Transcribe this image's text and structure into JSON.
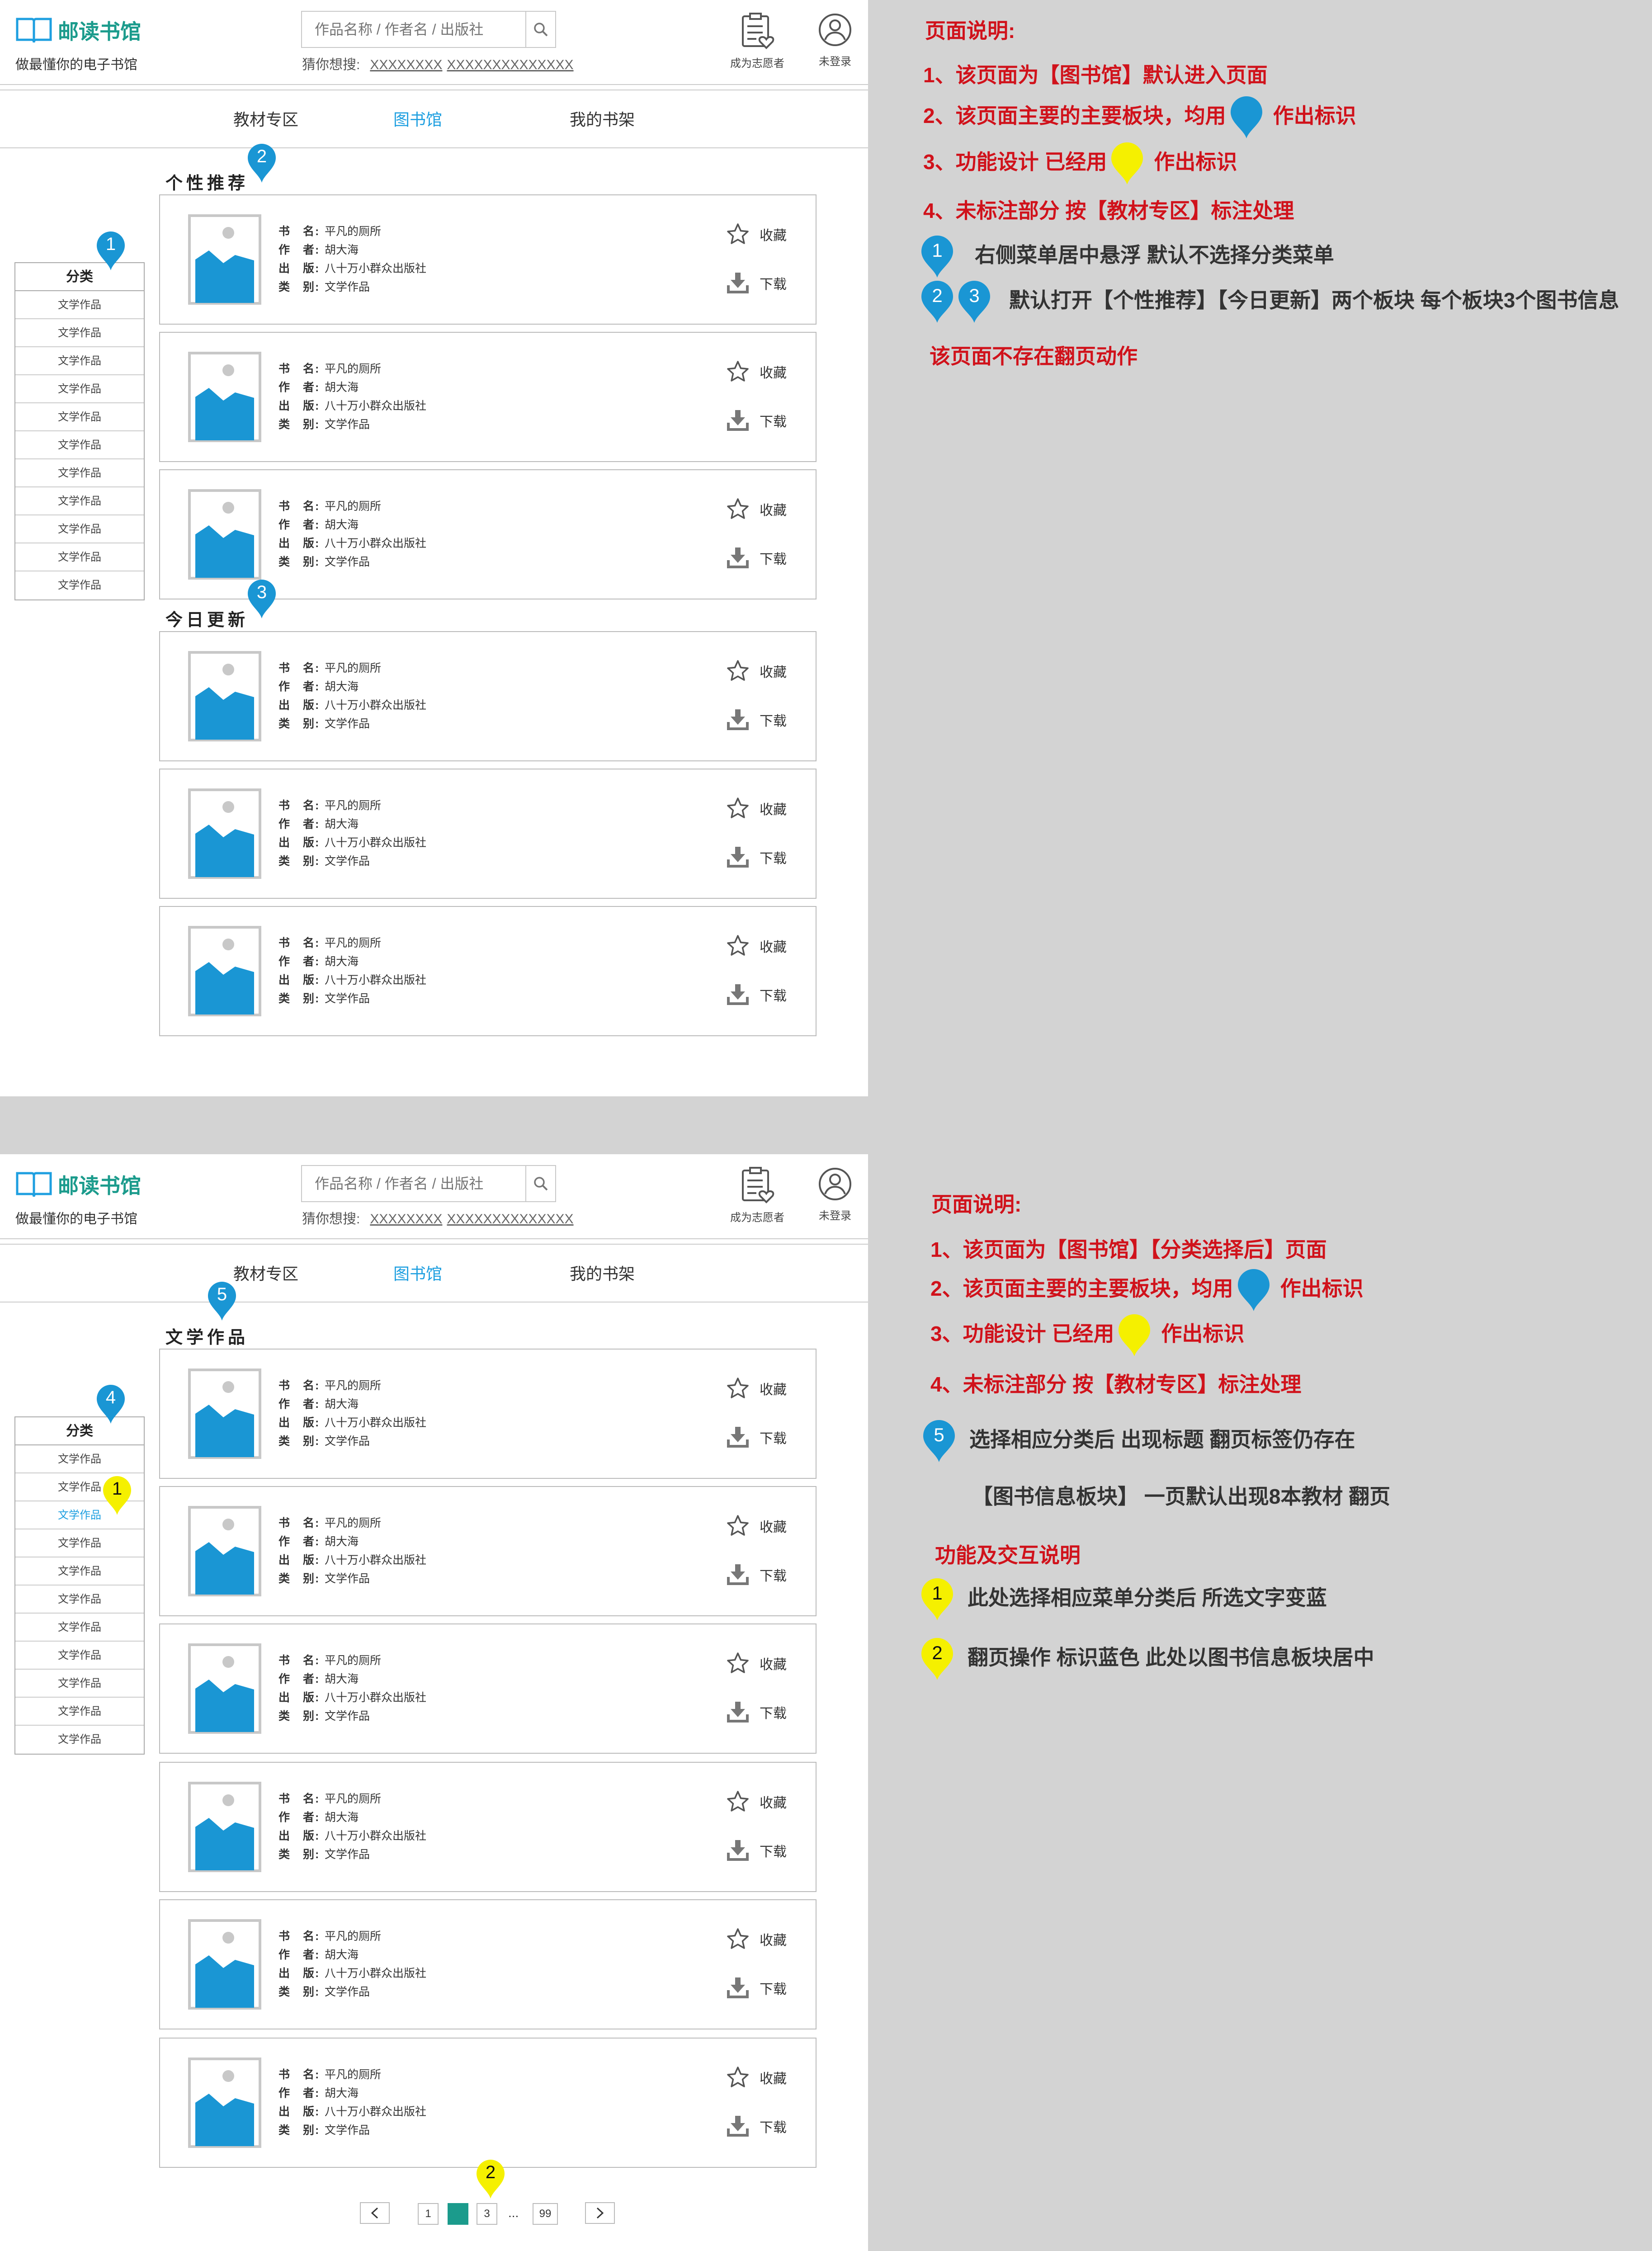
{
  "header": {
    "logo_title": "邮读书馆",
    "slogan": "做最懂你的电子书馆",
    "search_placeholder": "作品名称 / 作者名 / 出版社",
    "guess_label": "猜你想搜:",
    "guess_terms": [
      "XXXXXXXX",
      "XXXXXXXXXXXXXX"
    ],
    "volunteer_label": "成为志愿者",
    "login_label": "未登录"
  },
  "nav": {
    "items": [
      "教材专区",
      "图书馆",
      "我的书架"
    ],
    "active": "图书馆"
  },
  "category": {
    "header": "分类",
    "items": [
      "文学作品",
      "文学作品",
      "文学作品",
      "文学作品",
      "文学作品",
      "文学作品",
      "文学作品",
      "文学作品",
      "文学作品",
      "文学作品",
      "文学作品"
    ],
    "selected_index_page2": 2,
    "selected_color": "#1e9fe0"
  },
  "book": {
    "name_key": "书　名:",
    "name": "平凡的厕所",
    "author_key": "作　者:",
    "author": "胡大海",
    "publisher_key": "出　版:",
    "publisher": "八十万小群众出版社",
    "type_key": "类　别:",
    "type": "文学作品",
    "collect_label": "收藏",
    "download_label": "下载"
  },
  "page1": {
    "section_recommend": "个性推荐",
    "section_today": "今日更新",
    "markers": [
      "1",
      "2",
      "3"
    ]
  },
  "page2": {
    "section_title": "文学作品",
    "markers": [
      "5",
      "4",
      "1",
      "2"
    ],
    "pagination": {
      "prev": "<",
      "pages": [
        "1",
        "2",
        "3"
      ],
      "current": "2",
      "ellipsis": "...",
      "last": "99",
      "next": ">"
    }
  },
  "notes1": {
    "title": "页面说明:",
    "line1": "1、该页面为【图书馆】默认进入页面",
    "line2a": "2、该页面主要的主要板块，均用",
    "line2b": "作出标识",
    "line3a": "3、功能设计 已经用",
    "line3b": "作出标识",
    "line4": "4、未标注部分 按【教材专区】标注处理",
    "m1_text": "右侧菜单居中悬浮 默认不选择分类菜单",
    "m23_text": "默认打开【个性推荐】【今日更新】两个板块 每个板块3个图书信息",
    "no_paging": "该页面不存在翻页动作",
    "marker_1": "1",
    "marker_2": "2",
    "marker_3": "3"
  },
  "notes2": {
    "title": "页面说明:",
    "line1": "1、该页面为【图书馆】【分类选择后】页面",
    "line2a": "2、该页面主要的主要板块，均用",
    "line2b": "作出标识",
    "line3a": "3、功能设计 已经用",
    "line3b": "作出标识",
    "line4": "4、未标注部分 按【教材专区】标注处理",
    "m5_text": "选择相应分类后 出现标题 翻页标签仍存在",
    "book_block": "【图书信息板块】 一页默认出现8本教材 翻页",
    "func_title": "功能及交互说明",
    "y1_text": "此处选择相应菜单分类后 所选文字变蓝",
    "y2_text": "翻页操作 标识蓝色 此处以图书信息板块居中",
    "marker_5": "5",
    "ymarker_1": "1",
    "ymarker_2": "2"
  },
  "colors": {
    "brand": "#1b9b8c",
    "nav_active": "#1e9fe0",
    "marker_blue": "#1a96d4",
    "marker_yellow": "#f5f000",
    "note_red": "#d0121b"
  }
}
